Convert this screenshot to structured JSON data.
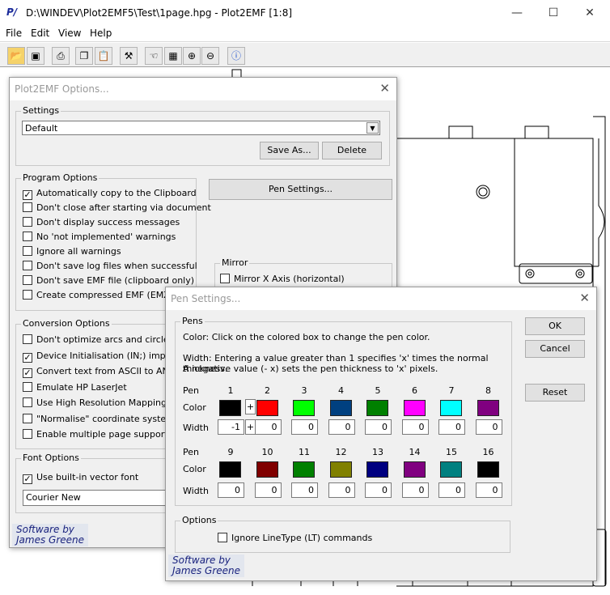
{
  "app": {
    "title": "D:\\WINDEV\\Plot2EMF5\\Test\\1page.hpg - Plot2EMF [1:8]",
    "logo": "P/"
  },
  "window_controls": {
    "minimize": "—",
    "maximize": "☐",
    "close": "✕"
  },
  "menu": [
    "File",
    "Edit",
    "View",
    "Help"
  ],
  "toolbar": [
    "open-icon",
    "properties-icon",
    "print-icon",
    "copy-icon",
    "paste-icon",
    "settings-icon",
    "zoom-100-icon",
    "fit-page-icon",
    "zoom-in-icon",
    "zoom-out-icon",
    "help-icon"
  ],
  "options_dialog": {
    "title": "Plot2EMF Options...",
    "close": "✕",
    "settings": {
      "legend": "Settings",
      "value": "Default",
      "save_as": "Save As...",
      "delete": "Delete"
    },
    "pen_settings_button": "Pen Settings...",
    "program_options": {
      "legend": "Program Options",
      "items": [
        {
          "label": "Automatically copy to the Clipboard",
          "checked": true
        },
        {
          "label": "Don't close after starting via document",
          "checked": false
        },
        {
          "label": "Don't display success messages",
          "checked": false
        },
        {
          "label": "No 'not implemented' warnings",
          "checked": false
        },
        {
          "label": "Ignore all warnings",
          "checked": false
        },
        {
          "label": "Don't save log files when successful",
          "checked": false
        },
        {
          "label": "Don't save EMF file (clipboard only)",
          "checked": false
        },
        {
          "label": "Create compressed EMF (EMZ) file",
          "checked": false
        }
      ]
    },
    "mirror": {
      "legend": "Mirror",
      "x_axis": "Mirror X Axis (horizontal)"
    },
    "conversion_options": {
      "legend": "Conversion Options",
      "items": [
        {
          "label": "Don't optimize arcs and circles",
          "checked": false
        },
        {
          "label": "Device Initialisation (IN;) implied",
          "checked": true
        },
        {
          "label": "Convert text from ASCII to ANSI",
          "checked": true
        },
        {
          "label": "Emulate HP LaserJet",
          "checked": false
        },
        {
          "label": "Use High Resolution Mapping Mode",
          "checked": false
        },
        {
          "label": "\"Normalise\" coordinate system",
          "checked": false
        },
        {
          "label": "Enable multiple page support",
          "checked": false
        }
      ]
    },
    "font_options": {
      "legend": "Font Options",
      "vector": "Use built-in vector font",
      "font": "Courier New"
    },
    "signature": {
      "line1": "Software by",
      "line2": "James Greene"
    }
  },
  "pen_dialog": {
    "title": "Pen Settings...",
    "close": "✕",
    "pens_legend": "Pens",
    "help1": "Color: Click on the colored box to change the pen color.",
    "help2": "Width: Entering a value greater than 1 specifies 'x' times the normal thickness.",
    "help3": "A negative value (- x) sets the pen thickness to 'x' pixels.",
    "labels": {
      "pen": "Pen",
      "color": "Color",
      "width": "Width",
      "plus": "+"
    },
    "pens_row1": [
      {
        "n": "1",
        "color": "#000000",
        "width": "-1"
      },
      {
        "n": "2",
        "color": "#ff0000",
        "width": "0"
      },
      {
        "n": "3",
        "color": "#00ff00",
        "width": "0"
      },
      {
        "n": "4",
        "color": "#004080",
        "width": "0"
      },
      {
        "n": "5",
        "color": "#008000",
        "width": "0"
      },
      {
        "n": "6",
        "color": "#ff00ff",
        "width": "0"
      },
      {
        "n": "7",
        "color": "#00ffff",
        "width": "0"
      },
      {
        "n": "8",
        "color": "#800080",
        "width": "0"
      }
    ],
    "pens_row2": [
      {
        "n": "9",
        "color": "#000000",
        "width": "0"
      },
      {
        "n": "10",
        "color": "#800000",
        "width": "0"
      },
      {
        "n": "11",
        "color": "#008000",
        "width": "0"
      },
      {
        "n": "12",
        "color": "#808000",
        "width": "0"
      },
      {
        "n": "13",
        "color": "#000080",
        "width": "0"
      },
      {
        "n": "14",
        "color": "#800080",
        "width": "0"
      },
      {
        "n": "15",
        "color": "#008080",
        "width": "0"
      },
      {
        "n": "16",
        "color": "#000000",
        "width": "0"
      }
    ],
    "options_legend": "Options",
    "ignore_lt": "Ignore LineType (LT) commands",
    "ok": "OK",
    "cancel": "Cancel",
    "reset": "Reset",
    "signature": {
      "line1": "Software by",
      "line2": "James Greene"
    }
  }
}
